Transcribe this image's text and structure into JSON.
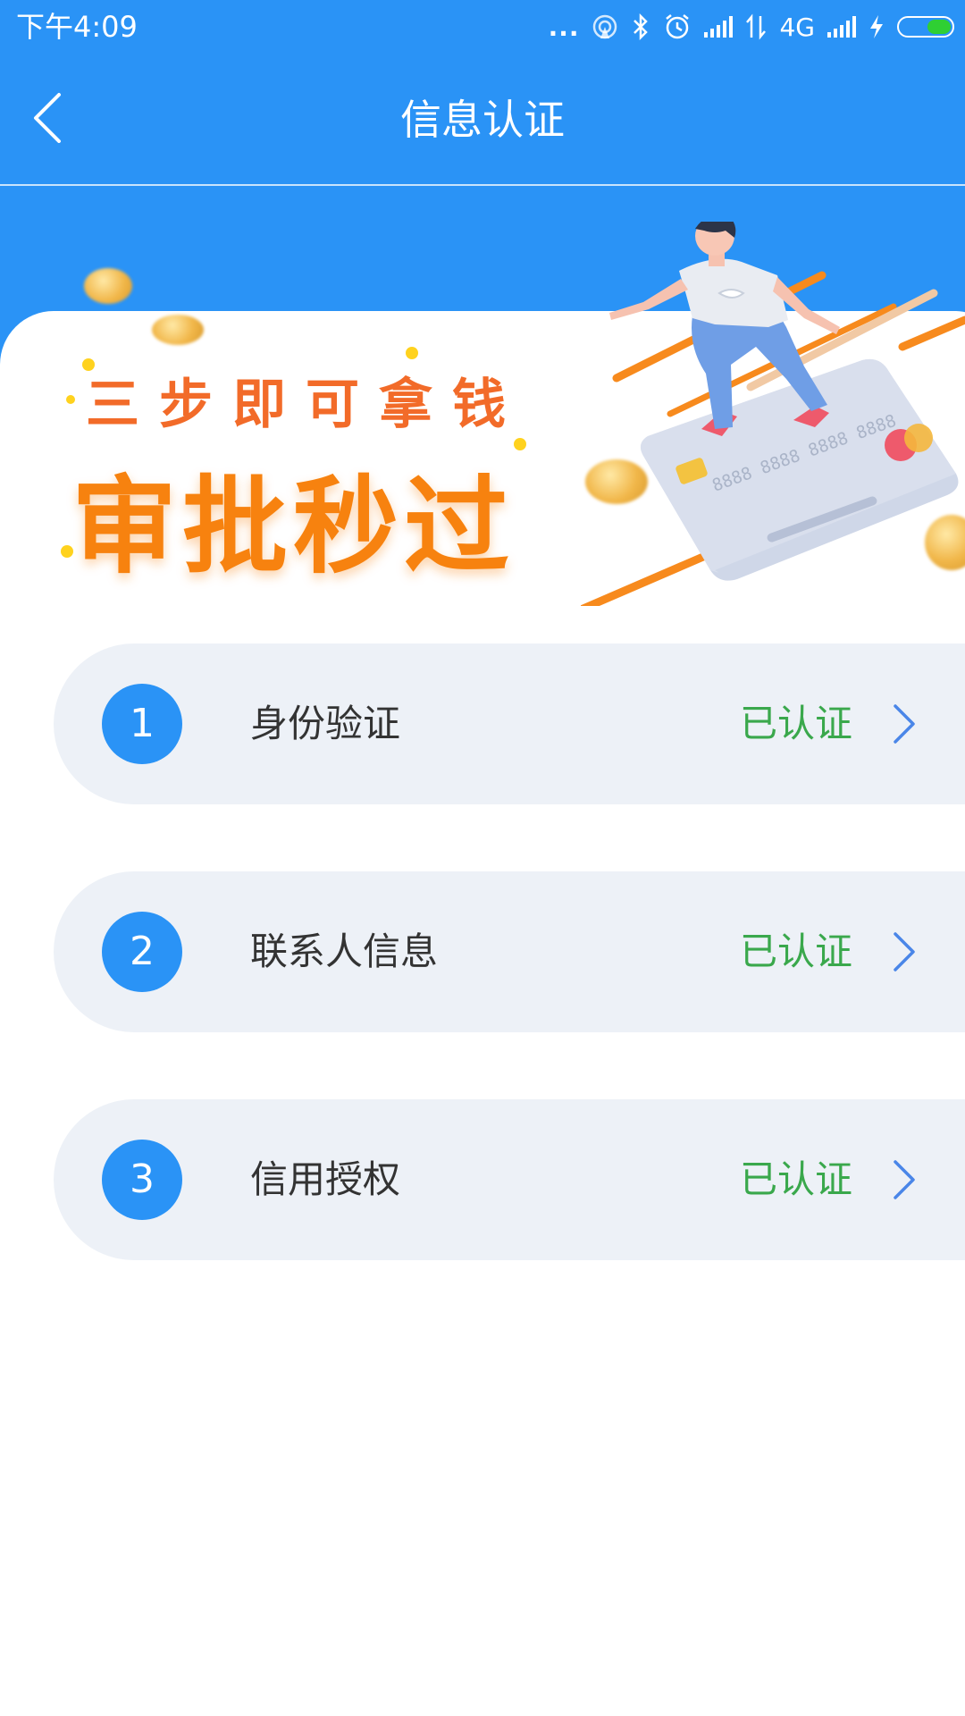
{
  "status_bar": {
    "time": "下午4:09",
    "dots": "...",
    "network_label": "4G"
  },
  "header": {
    "title": "信息认证"
  },
  "banner": {
    "slogan": "三步即可拿钱",
    "headline": "审批秒过",
    "card_number_text": "8888 8888 8888 8888"
  },
  "steps": [
    {
      "number": "1",
      "label": "身份验证",
      "status": "已认证"
    },
    {
      "number": "2",
      "label": "联系人信息",
      "status": "已认证"
    },
    {
      "number": "3",
      "label": "信用授权",
      "status": "已认证"
    }
  ],
  "colors": {
    "primary": "#2a93f6",
    "verified": "#3aa84c",
    "slogan_orange": "#f26b29",
    "headline_orange": "#f7820f",
    "row_background": "#edf1f7",
    "battery_green": "#2fcf33"
  }
}
